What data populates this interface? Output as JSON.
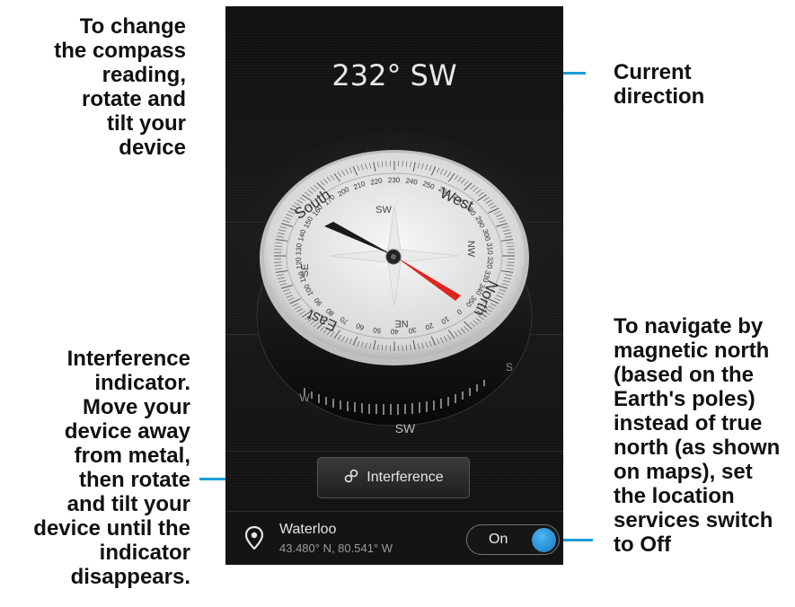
{
  "callouts": {
    "left_top": "To change\nthe compass\nreading,\nrotate and\ntilt your\ndevice",
    "left_bottom": "Interference\nindicator.\nMove your\ndevice away\nfrom metal,\nthen rotate\nand tilt your\ndevice until the\nindicator\ndisappears.",
    "right_top": "Current\ndirection",
    "right_bottom": "To navigate by\nmagnetic north\n(based on the\nEarth's poles)\ninstead of true\nnorth (as shown\non maps), set\nthe location\nservices switch\nto Off"
  },
  "compass": {
    "direction": "232° SW",
    "cardinals": {
      "north": "North",
      "south": "South",
      "east": "East",
      "west": "West"
    },
    "intercardinals": [
      "SW",
      "NW",
      "NE",
      "SE"
    ],
    "outer_ring_label": "SW",
    "outer_ring_letters": {
      "west": "W",
      "south": "S"
    },
    "degree_labels": [
      "200",
      "210",
      "220",
      "230",
      "240",
      "250",
      "260",
      "270",
      "280",
      "290",
      "300",
      "310",
      "320",
      "330",
      "340",
      "350",
      "0",
      "10",
      "20",
      "30",
      "40",
      "50",
      "60",
      "70",
      "80",
      "90",
      "100",
      "110",
      "120",
      "130",
      "140",
      "150",
      "160",
      "170"
    ],
    "needle_colors": {
      "north": "#e0241e",
      "south": "#1a1a1a"
    },
    "accent": "#1b9bd7"
  },
  "interference_button": {
    "label": "Interference",
    "icon": "link-icon"
  },
  "location": {
    "name": "Waterloo",
    "coords": "43.480° N, 80.541° W",
    "icon": "map-pin-icon"
  },
  "location_toggle": {
    "label": "On",
    "state": true,
    "knob_color": "#1b8fdc"
  }
}
